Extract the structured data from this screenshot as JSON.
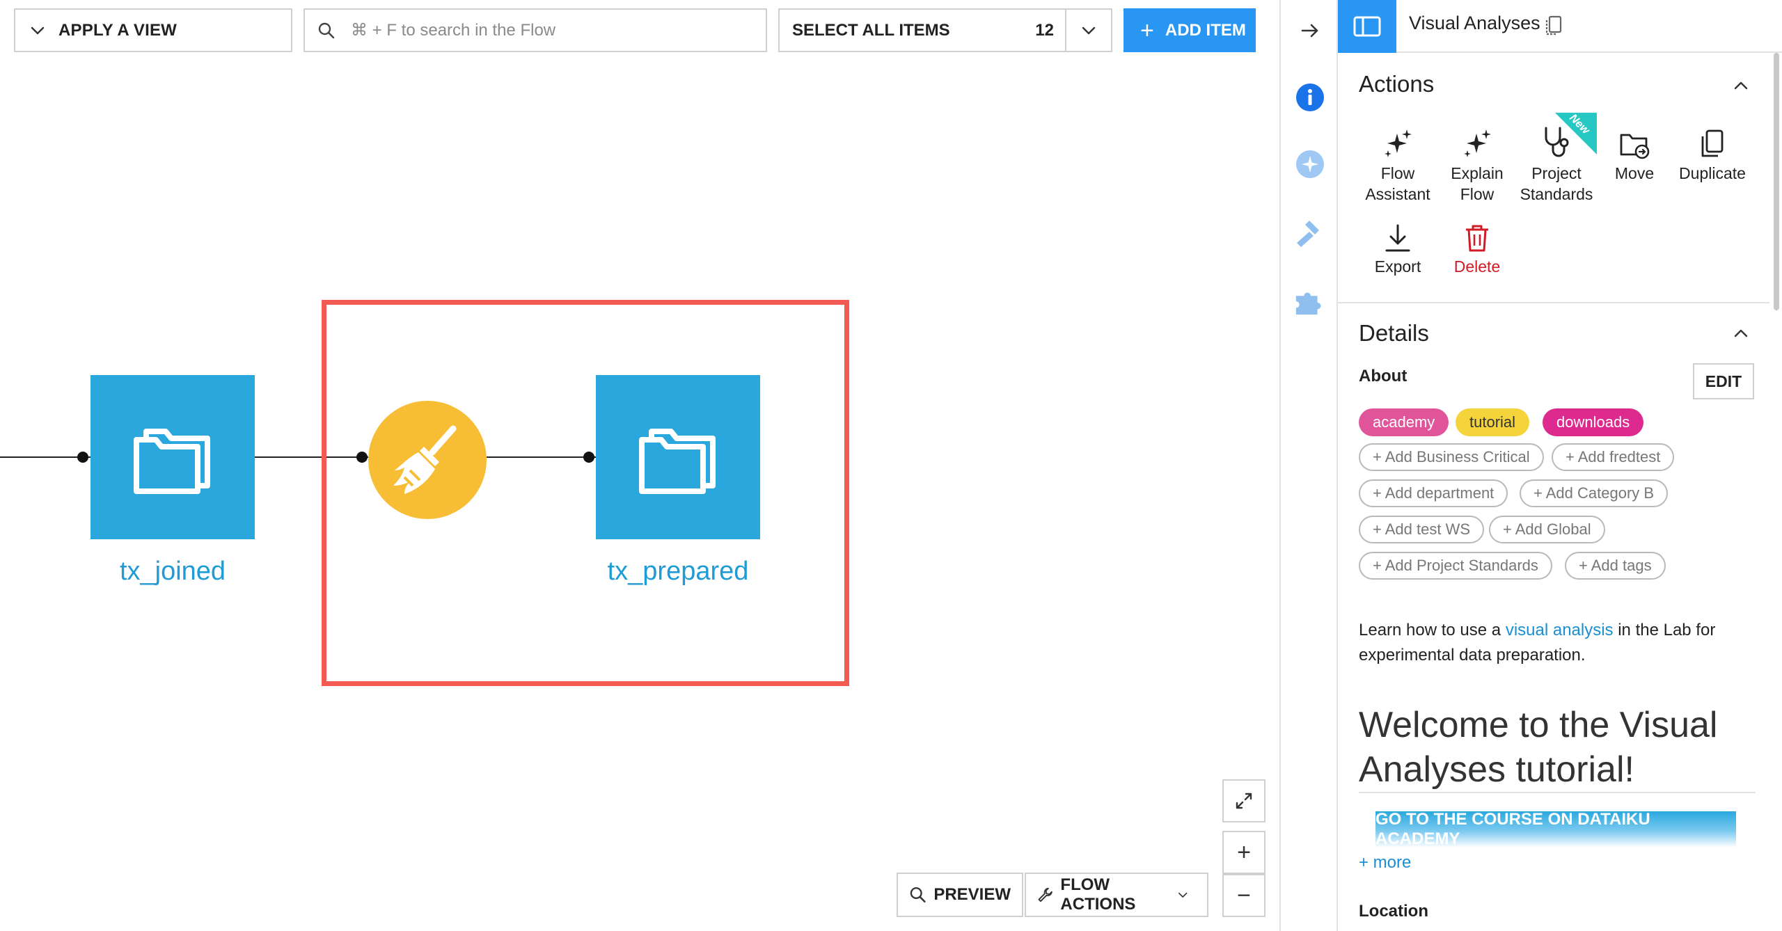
{
  "toolbar": {
    "apply_view_label": "APPLY A VIEW",
    "search_placeholder": "⌘ + F to search in the Flow",
    "select_all_label": "SELECT ALL ITEMS",
    "select_count": "12",
    "add_item_label": "ADD ITEM"
  },
  "flow": {
    "datasets": [
      {
        "name": "tx_joined"
      },
      {
        "name": "tx_prepared"
      }
    ],
    "recipe_icon": "broom-icon",
    "highlight_color": "#f35b52",
    "dataset_color": "#2aa8de",
    "recipe_color": "#f7be35"
  },
  "canvas_controls": {
    "preview_label": "PREVIEW",
    "flow_actions_label": "FLOW ACTIONS",
    "zoom_in_symbol": "+",
    "zoom_out_symbol": "−"
  },
  "rail": {
    "icons": [
      "arrow-right-icon",
      "info-icon",
      "ai-sparkle-icon",
      "hammer-icon",
      "puzzle-icon"
    ]
  },
  "panel": {
    "title": "Visual Analyses",
    "actions_title": "Actions",
    "actions": [
      {
        "label_1": "Flow",
        "label_2": "Assistant",
        "icon": "sparkle-icon"
      },
      {
        "label_1": "Explain",
        "label_2": "Flow",
        "icon": "sparkle-icon"
      },
      {
        "label_1": "Project",
        "label_2": "Standards",
        "icon": "stethoscope-icon",
        "badge": "New"
      },
      {
        "label_1": "Move",
        "label_2": "",
        "icon": "folder-move-icon"
      },
      {
        "label_1": "Duplicate",
        "label_2": "",
        "icon": "duplicate-icon"
      },
      {
        "label_1": "Export",
        "label_2": "",
        "icon": "download-icon"
      },
      {
        "label_1": "Delete",
        "label_2": "",
        "icon": "trash-icon"
      }
    ],
    "details_title": "Details",
    "about_label": "About",
    "edit_label": "EDIT",
    "tags": [
      {
        "label": "academy",
        "color": "#e0559a"
      },
      {
        "label": "tutorial",
        "color": "#f5d33a"
      },
      {
        "label": "downloads",
        "color": "#de2a8e"
      }
    ],
    "add_tags": [
      "+ Add Business Critical",
      "+ Add fredtest",
      "+ Add department",
      "+ Add Category B",
      "+ Add test WS",
      "+ Add Global",
      "+ Add Project Standards",
      "+ Add tags"
    ],
    "description": {
      "before": "Learn how to use a ",
      "link": "visual analysis",
      "after": " in the Lab for experimental data preparation."
    },
    "welcome_heading": "Welcome to the Visual Analyses tutorial!",
    "course_button": "GO TO THE COURSE ON DATAIKU ACADEMY",
    "more_link": "+ more",
    "location_label": "Location"
  },
  "colors": {
    "accent_blue": "#2a96f3",
    "link_blue": "#1a8fd2",
    "danger_red": "#d11c25"
  }
}
